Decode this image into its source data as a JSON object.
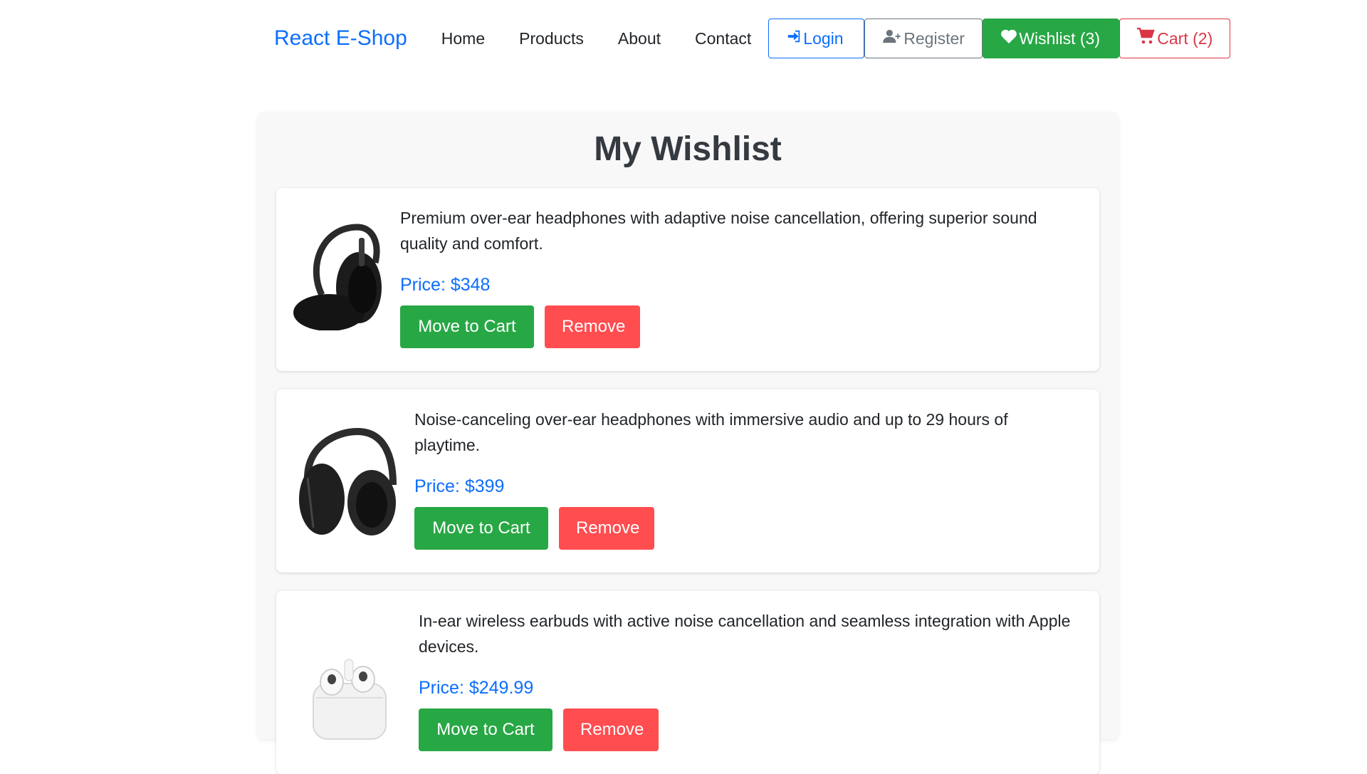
{
  "navbar": {
    "brand": "React E-Shop",
    "links": [
      "Home",
      "Products",
      "About",
      "Contact"
    ],
    "login_label": "Login",
    "register_label": "Register",
    "wishlist_label": "Wishlist (3)",
    "cart_label": "Cart (2)",
    "icons": {
      "login": "sign-in-icon",
      "register": "user-plus-icon",
      "wishlist": "heart-icon",
      "cart": "cart-icon"
    }
  },
  "page": {
    "title": "My Wishlist"
  },
  "wishlist": [
    {
      "description": "Premium over-ear headphones with adaptive noise cancellation, offering superior sound quality and comfort.",
      "price": "Price: $348",
      "move_label": "Move to Cart",
      "remove_label": "Remove"
    },
    {
      "description": "Noise-canceling over-ear headphones with immersive audio and up to 29 hours of playtime.",
      "price": "Price: $399",
      "move_label": "Move to Cart",
      "remove_label": "Remove"
    },
    {
      "description": "In-ear wireless earbuds with active noise cancellation and seamless integration with Apple devices.",
      "price": "Price: $249.99",
      "move_label": "Move to Cart",
      "remove_label": "Remove"
    }
  ],
  "colors": {
    "primary": "#0d6efd",
    "success": "#28a745",
    "danger": "#dc3545",
    "remove": "#ff4d50",
    "secondary": "#6c757d"
  }
}
